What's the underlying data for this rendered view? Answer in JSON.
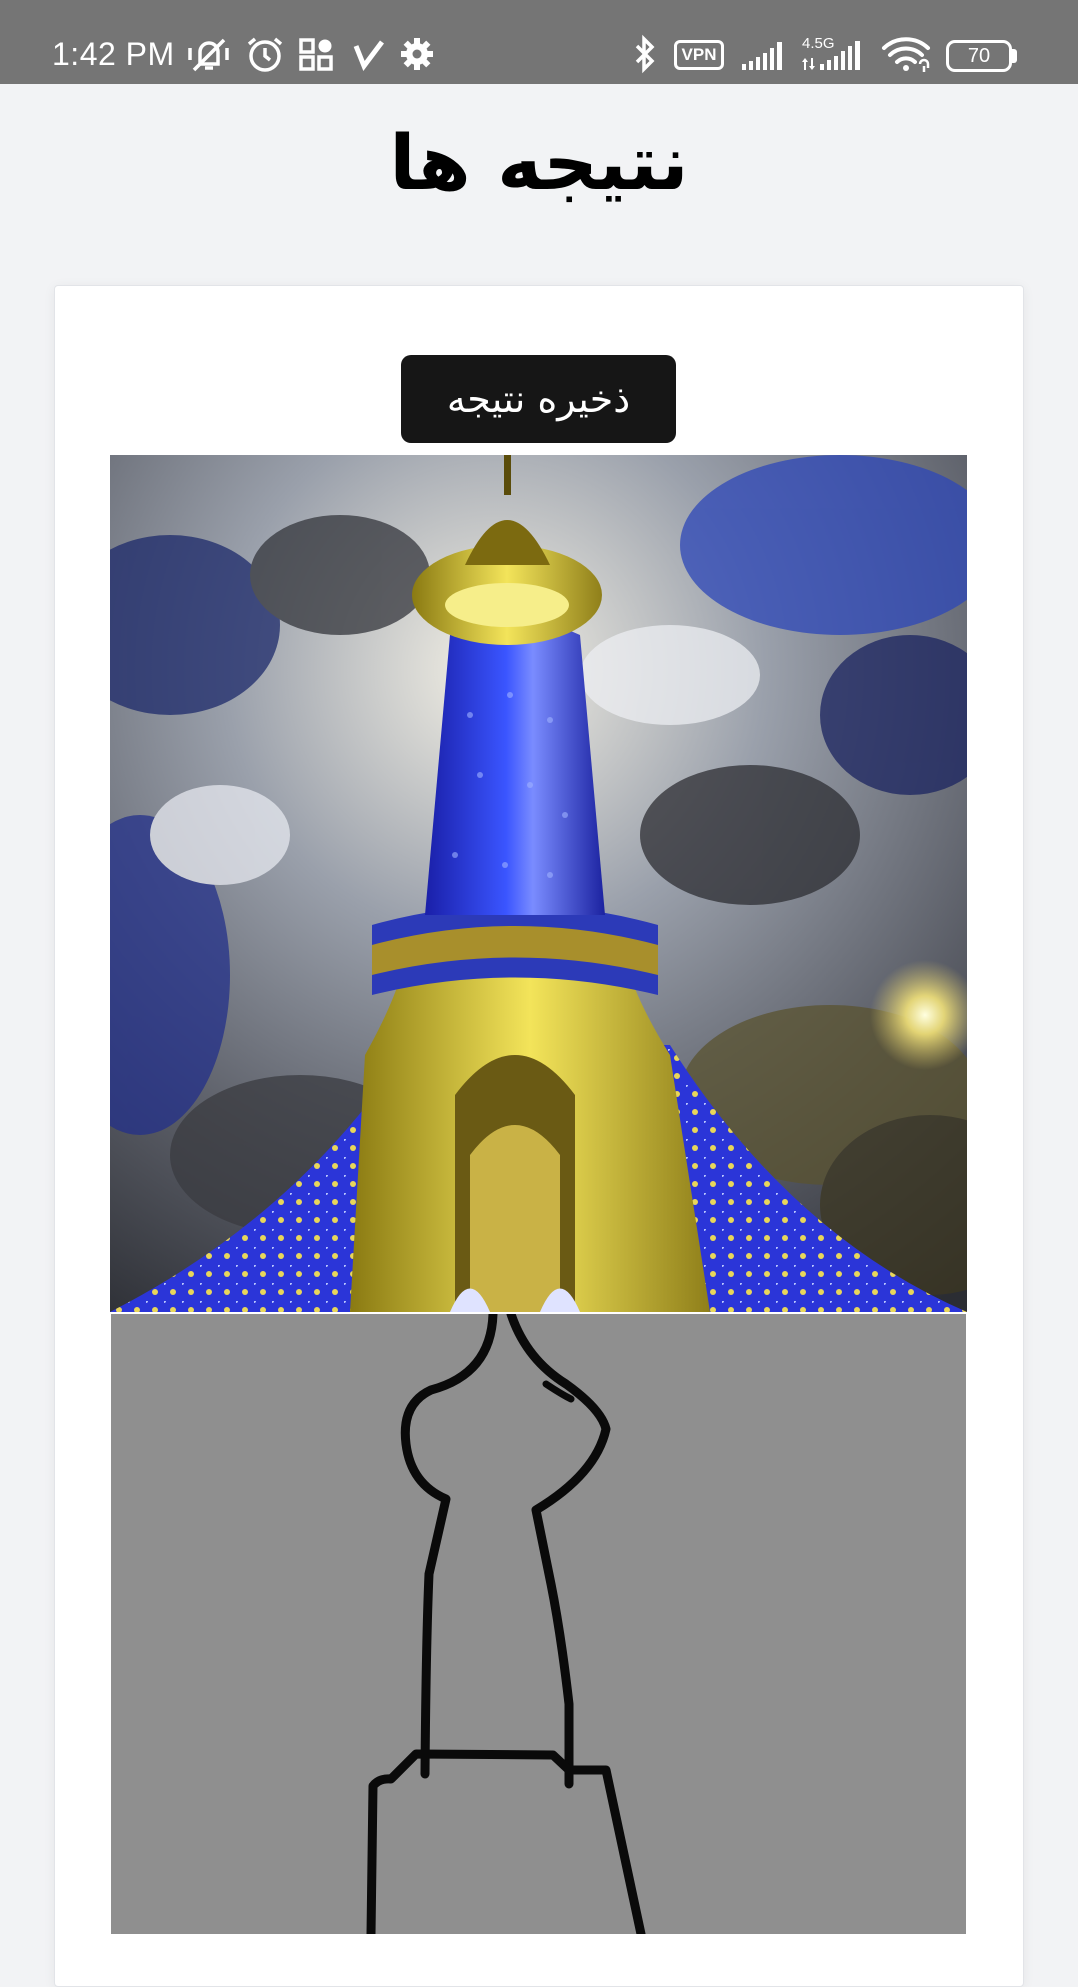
{
  "status_bar": {
    "time": "1:42 PM",
    "vpn_label": "VPN",
    "network_type": "4.5G",
    "battery_level": "70",
    "icons": [
      "mute-vibrate-icon",
      "alarm-icon",
      "apps-icon",
      "check-icon",
      "settings-gear-icon",
      "bluetooth-icon",
      "vpn-icon",
      "signal-icon",
      "signal-icon",
      "wifi-icon",
      "battery-icon"
    ]
  },
  "page": {
    "title": "نتیجه ها"
  },
  "card": {
    "save_button_label": "ذخیره نتیجه",
    "generated_image": "ornate-blue-gold-tower-under-dramatic-clouds",
    "sketch_image": "black-line-sketch-of-tower-on-gray"
  },
  "colors": {
    "status_bar_bg": "#757575",
    "page_bg": "#f2f3f5",
    "card_bg": "#ffffff",
    "button_bg": "#161616",
    "sketch_bg": "#8f8f8f"
  }
}
